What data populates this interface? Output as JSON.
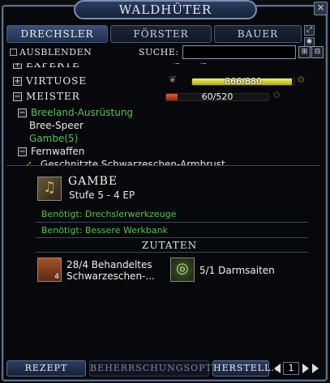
{
  "window": {
    "title": "WALDHÜTER",
    "close": "×"
  },
  "tabs": [
    {
      "label": "DRECHSLER",
      "active": true
    },
    {
      "label": "FÖRSTER",
      "active": false
    },
    {
      "label": "BAUER",
      "active": false
    }
  ],
  "filter": {
    "hide_label": "AUSBLENDEN",
    "search_label": "SUCHE:",
    "search_value": ""
  },
  "list": {
    "experte": {
      "label": "EXPERTE"
    },
    "virtuose": {
      "label": "VIRTUOSE",
      "progress_text": "866/880",
      "progress": 0.984
    },
    "meister": {
      "label": "MEISTER",
      "progress_text": "60/520",
      "progress": 0.115
    },
    "groups": [
      {
        "label": "Breeland-Ausrüstung",
        "items": [
          "Bree-Speer",
          "Gambe(5)"
        ]
      },
      {
        "label": "Fernwaffen",
        "items": [
          "Geschnitzte Schwarzeschen-Armbrust"
        ]
      }
    ]
  },
  "detail": {
    "name": "GAMBE",
    "tier": "Stufe 5 - 4 EP",
    "requirements": [
      "Benötigt: Drechslerwerkzeuge",
      "Benötigt: Bessere Werkbank"
    ],
    "ingredients_title": "ZUTATEN",
    "ingredients": [
      {
        "line1": "28/4 Behandeltes",
        "line2": "Schwarzeschen-...",
        "count": "4"
      },
      {
        "line1": "5/1 Darmsaiten",
        "line2": "",
        "count": ""
      }
    ]
  },
  "bottom": {
    "recipe": "REZEPT",
    "mastery": "BEHERRSCHUNGSOPTIO...",
    "craft": "HERSTELL...",
    "quantity": "1"
  },
  "colors": {
    "accent": "#2b3d61",
    "green_text": "#57c25a",
    "bar_yellow": "#d8d82a",
    "bar_red": "#c8321e"
  }
}
